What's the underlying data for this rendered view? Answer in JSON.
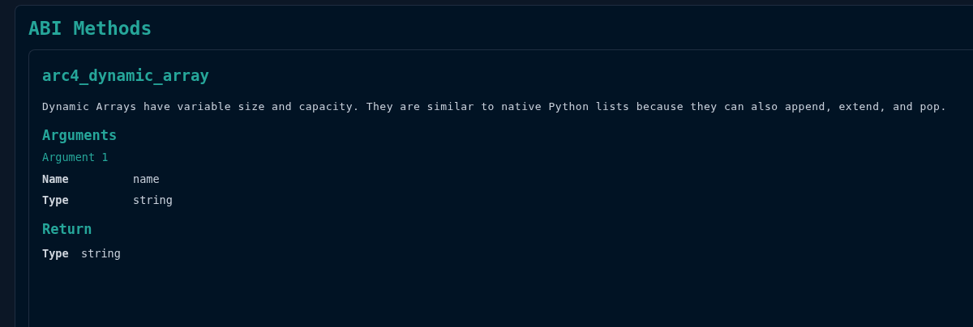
{
  "section": {
    "title": "ABI Methods",
    "methods": [
      {
        "name": "arc4_dynamic_array",
        "description": "Dynamic Arrays have variable size and capacity. They are similar to native Python lists because they can also append, extend, and pop.",
        "arguments_title": "Arguments",
        "arguments": [
          {
            "title": "Argument 1",
            "fields": [
              {
                "label": "Name",
                "value": "name"
              },
              {
                "label": "Type",
                "value": "string"
              }
            ]
          }
        ],
        "return_title": "Return",
        "return": {
          "label": "Type",
          "value": "string"
        }
      }
    ]
  }
}
